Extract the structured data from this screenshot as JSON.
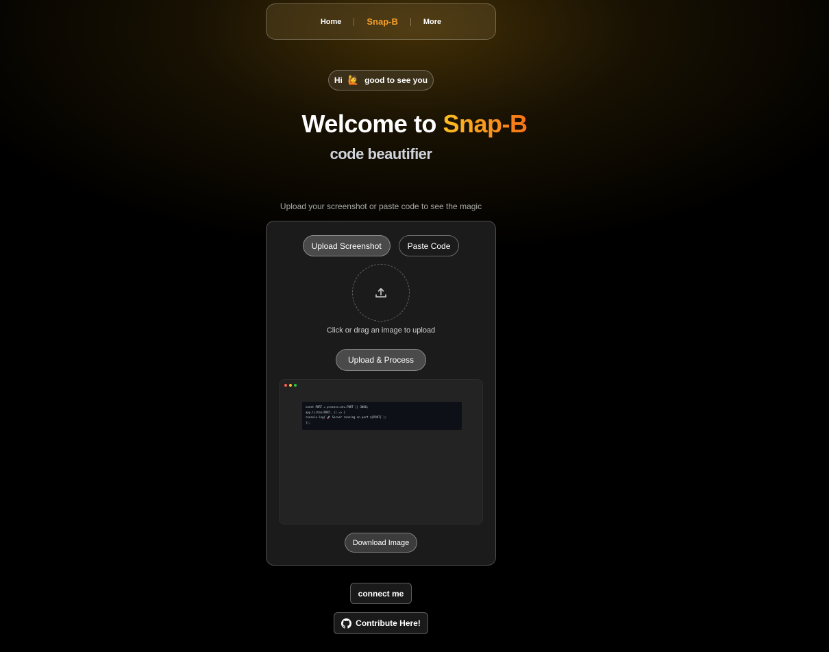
{
  "nav": {
    "home_label": "Home",
    "brand_label": "Snap-B",
    "more_label": "More"
  },
  "greeting": {
    "hi": "Hi",
    "emoji": "🙋",
    "text": "good to see you"
  },
  "hero": {
    "title_prefix": "Welcome to",
    "title_brand": "Snap-B",
    "subtitle": "code beautifier",
    "tagline": "Upload your screenshot or paste code to see the magic"
  },
  "panel": {
    "tab_upload": "Upload Screenshot",
    "tab_paste": "Paste Code",
    "active_tab": "Upload Screenshot",
    "upload_hint": "Click or drag an image to upload",
    "process_button": "Upload & Process",
    "download_button": "Download Image",
    "preview": {
      "window_dot_colors": [
        "#ff5f56",
        "#ffbd2e",
        "#27c93f"
      ],
      "code_lines": [
        "const PORT = process.env.PORT || 3000;",
        "app.listen(PORT, () => {",
        "  console.log(`🚀 Server running on port ${PORT}`);",
        "});"
      ]
    }
  },
  "footer": {
    "connect_label": "connect me",
    "contribute_label": "Contribute Here!"
  },
  "colors": {
    "brand_orange": "#f59e2b",
    "background": "#000000",
    "panel_bg": "#1b1b1b"
  }
}
